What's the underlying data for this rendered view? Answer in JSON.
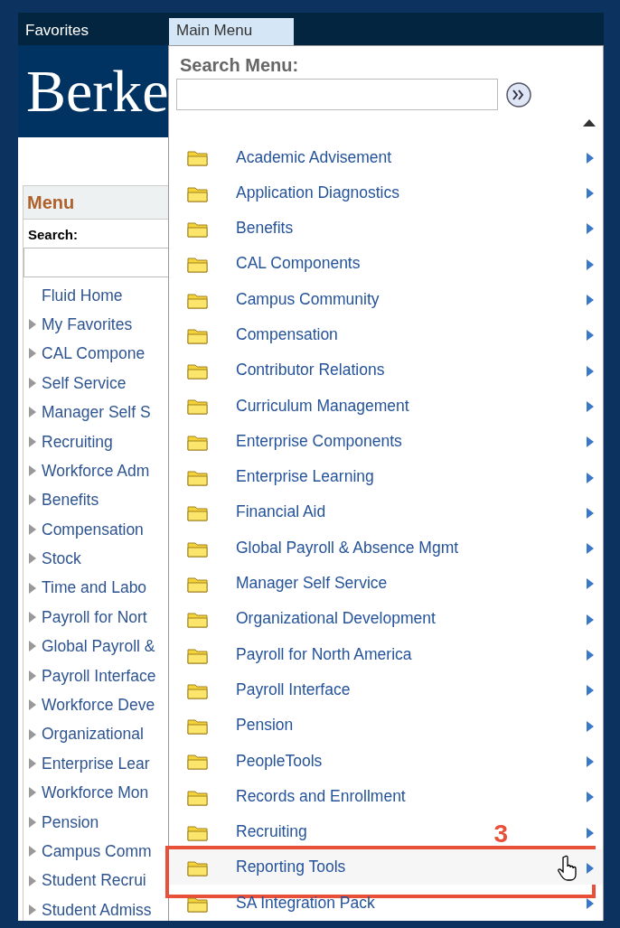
{
  "top_bar": {
    "tabs": [
      {
        "label": "Favorites",
        "selected": false
      },
      {
        "label": "Main Menu",
        "selected": true
      }
    ]
  },
  "banner": {
    "logo_text": "Berke"
  },
  "side_menu": {
    "title": "Menu",
    "search_label": "Search:",
    "items": [
      {
        "label": "Fluid Home",
        "expandable": false
      },
      {
        "label": "My Favorites",
        "expandable": true
      },
      {
        "label": "CAL Compone",
        "expandable": true
      },
      {
        "label": "Self Service",
        "expandable": true
      },
      {
        "label": "Manager Self S",
        "expandable": true
      },
      {
        "label": "Recruiting",
        "expandable": true
      },
      {
        "label": "Workforce Adm",
        "expandable": true
      },
      {
        "label": "Benefits",
        "expandable": true
      },
      {
        "label": "Compensation",
        "expandable": true
      },
      {
        "label": "Stock",
        "expandable": true
      },
      {
        "label": "Time and Labo",
        "expandable": true
      },
      {
        "label": "Payroll for Nort",
        "expandable": true
      },
      {
        "label": "Global Payroll &",
        "expandable": true
      },
      {
        "label": "Payroll Interface",
        "expandable": true
      },
      {
        "label": "Workforce Deve",
        "expandable": true
      },
      {
        "label": "Organizational",
        "expandable": true
      },
      {
        "label": "Enterprise Lear",
        "expandable": true
      },
      {
        "label": "Workforce Mon",
        "expandable": true
      },
      {
        "label": "Pension",
        "expandable": true
      },
      {
        "label": "Campus Comm",
        "expandable": true
      },
      {
        "label": "Student Recrui",
        "expandable": true
      },
      {
        "label": "Student Admiss",
        "expandable": true
      }
    ]
  },
  "main_menu_dropdown": {
    "search_label": "Search Menu:",
    "items": [
      {
        "label": "Academic Advisement",
        "highlighted": false
      },
      {
        "label": "Application Diagnostics",
        "highlighted": false
      },
      {
        "label": "Benefits",
        "highlighted": false
      },
      {
        "label": "CAL Components",
        "highlighted": false
      },
      {
        "label": "Campus Community",
        "highlighted": false
      },
      {
        "label": "Compensation",
        "highlighted": false
      },
      {
        "label": "Contributor Relations",
        "highlighted": false
      },
      {
        "label": "Curriculum Management",
        "highlighted": false
      },
      {
        "label": "Enterprise Components",
        "highlighted": false
      },
      {
        "label": "Enterprise Learning",
        "highlighted": false
      },
      {
        "label": "Financial Aid",
        "highlighted": false
      },
      {
        "label": "Global Payroll & Absence Mgmt",
        "highlighted": false
      },
      {
        "label": "Manager Self Service",
        "highlighted": false
      },
      {
        "label": "Organizational Development",
        "highlighted": false
      },
      {
        "label": "Payroll for North America",
        "highlighted": false
      },
      {
        "label": "Payroll Interface",
        "highlighted": false
      },
      {
        "label": "Pension",
        "highlighted": false
      },
      {
        "label": "PeopleTools",
        "highlighted": false
      },
      {
        "label": "Records and Enrollment",
        "highlighted": false
      },
      {
        "label": "Recruiting",
        "highlighted": false
      },
      {
        "label": "Reporting Tools",
        "highlighted": true
      },
      {
        "label": "SA Integration Pack",
        "highlighted": false
      }
    ]
  },
  "annotation": {
    "step": "3"
  }
}
